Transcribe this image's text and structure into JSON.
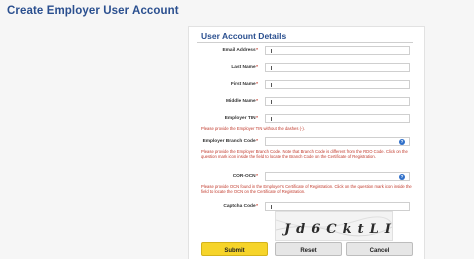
{
  "page": {
    "title": "Create Employer User Account"
  },
  "form": {
    "section_title": "User Account Details",
    "fields": {
      "email": {
        "label": "Email Address",
        "value": ""
      },
      "last_name": {
        "label": "Last Name",
        "value": ""
      },
      "first_name": {
        "label": "First Name",
        "value": ""
      },
      "middle_name": {
        "label": "Middle Name",
        "value": ""
      },
      "employer_tin": {
        "label": "Employer TIN",
        "value": ""
      },
      "branch_code": {
        "label": "Employer Branch Code",
        "value": ""
      },
      "cor_ocn": {
        "label": "COR-OCN",
        "value": ""
      },
      "captcha_code": {
        "label": "Captcha Code",
        "value": ""
      }
    },
    "required_mark": "*",
    "hints": {
      "tin": "Please provide the Employer TIN without the dashes (-).",
      "branch": "Please provide the Employer Branch Code. Note that Branch Code is different from the RDO Code. Click on the question mark icon inside the field to locate the Branch Code on the Certificate of Registration.",
      "ocn": "Please provide OCN found in the Employer's Certificate of Registration. Click on the question mark icon inside the field to locate the OCN on the Certificate of Registration."
    },
    "captcha_text": "Jd6CktLI",
    "help_glyph": "?"
  },
  "buttons": {
    "submit": "Submit",
    "reset": "Reset",
    "cancel": "Cancel"
  },
  "icons": {
    "help": "question-mark-icon"
  },
  "colors": {
    "title": "#2a4f8f",
    "error": "#c0392b",
    "submit": "#f6d42a",
    "help_icon": "#2f6fc9"
  }
}
